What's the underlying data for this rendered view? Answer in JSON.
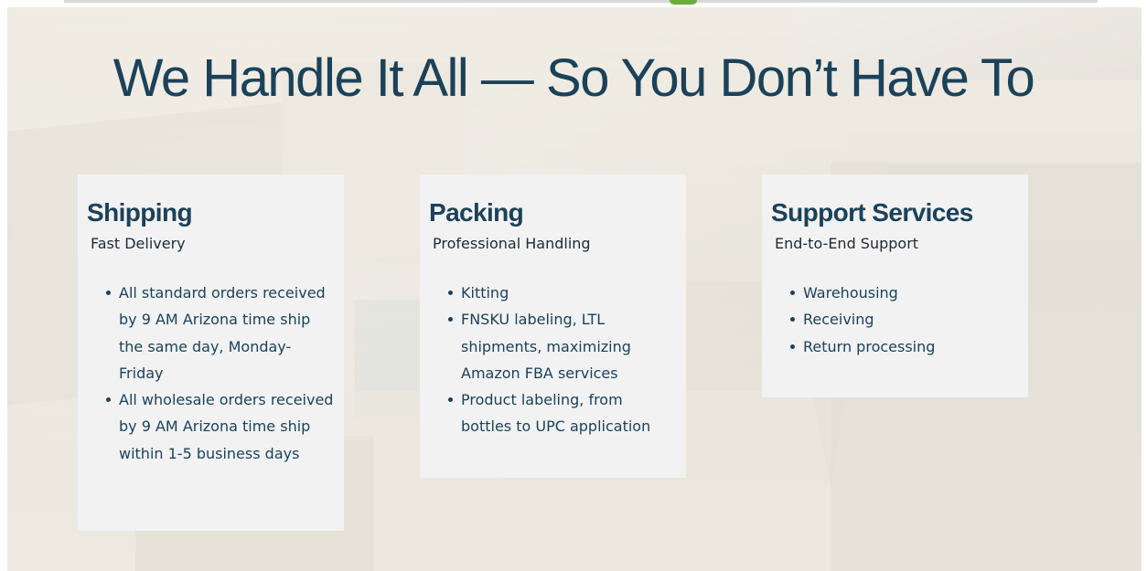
{
  "headline": "We Handle It All — So You Don’t Have To",
  "cards": [
    {
      "title": "Shipping",
      "subtitle": "Fast Delivery",
      "items": [
        "All standard orders received by 9 AM Arizona time ship the same day, Monday-Friday",
        "All wholesale orders received by 9 AM Arizona time ship within 1-5 business days"
      ]
    },
    {
      "title": "Packing",
      "subtitle": "Professional Handling",
      "items": [
        "Kitting",
        "FNSKU labeling, LTL shipments, maximizing Amazon FBA services",
        "Product labeling, from bottles to UPC application"
      ]
    },
    {
      "title": "Support Services",
      "subtitle": "End-to-End Support",
      "items": [
        "Warehousing",
        "Receiving",
        "Return processing"
      ]
    }
  ],
  "colors": {
    "heading": "#1b4259",
    "card_bg": "#f2f2f3",
    "accent": "#6cae3c"
  }
}
